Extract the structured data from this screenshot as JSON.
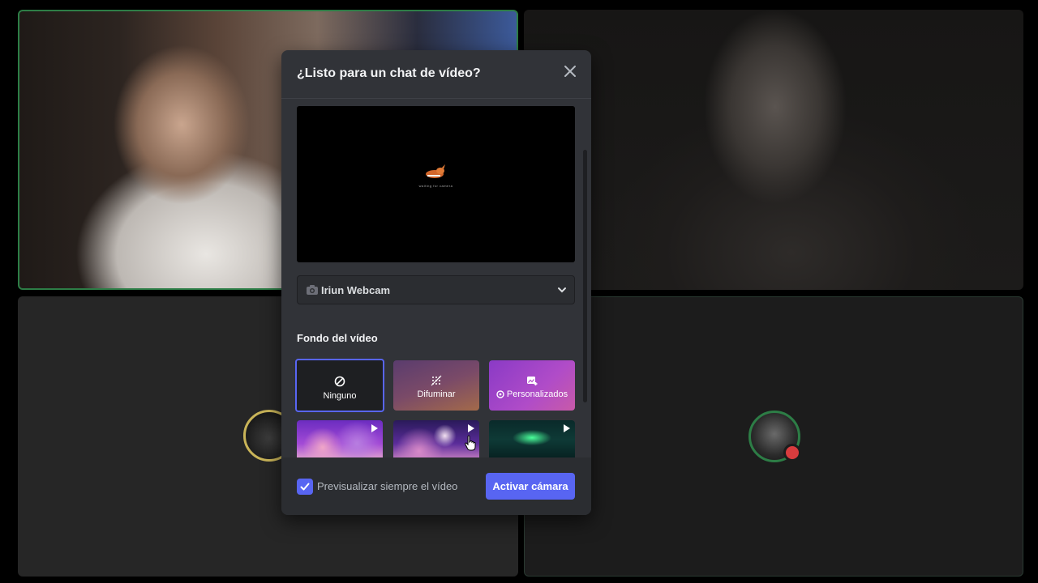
{
  "modal": {
    "title": "¿Listo para un chat de vídeo?",
    "camera_device": "Iriun Webcam",
    "background_section_label": "Fondo del vídeo",
    "background_options": [
      {
        "label": "Ninguno",
        "icon": "no-symbol-icon",
        "selected": true
      },
      {
        "label": "Difuminar",
        "icon": "blur-icon",
        "selected": false
      },
      {
        "label": "Personalizados",
        "icon": "add-image-icon",
        "selected": false
      }
    ],
    "background_thumbnails": [
      {
        "icon": "play-icon"
      },
      {
        "icon": "play-icon"
      },
      {
        "icon": "play-icon"
      }
    ],
    "always_preview_label": "Previsualizar siempre el vídeo",
    "always_preview_checked": true,
    "primary_button": "Activar cámara",
    "preview_caption": "waiting for camera"
  },
  "colors": {
    "accent": "#5865f2",
    "modal_bg": "#313338",
    "footer_bg": "#2b2d31",
    "speaking_border": "#2d7d46"
  }
}
